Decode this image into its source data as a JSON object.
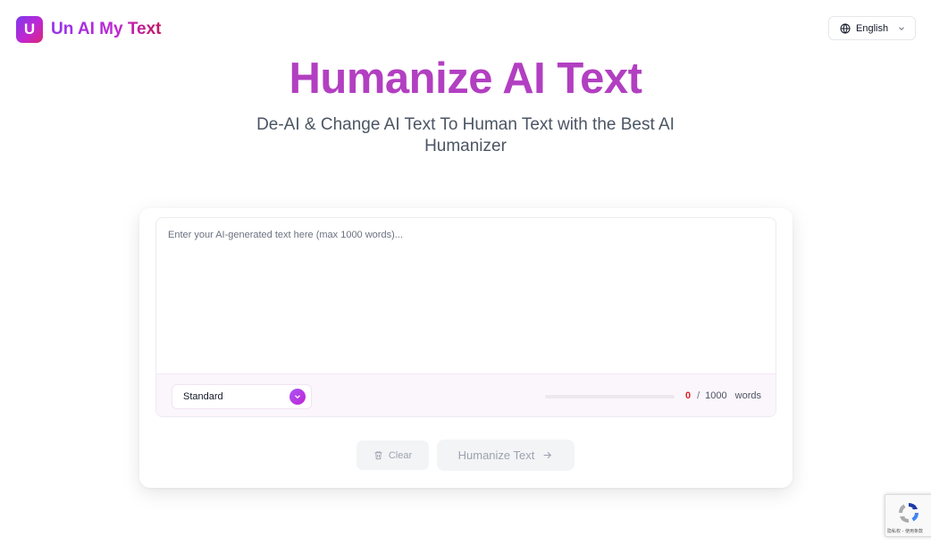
{
  "brand": {
    "logo_letter": "U",
    "name": "Un AI My Text"
  },
  "language": {
    "selected": "English",
    "icon": "globe-icon"
  },
  "hero": {
    "title": "Humanize AI Text",
    "subtitle": "De-AI & Change AI Text To Human Text with the Best AI Humanizer"
  },
  "editor": {
    "placeholder": "Enter your AI-generated text here (max 1000 words)...",
    "value": "",
    "mode": {
      "selected": "Standard"
    },
    "word_count": {
      "current": "0",
      "separator": "/",
      "max": "1000",
      "unit": "words",
      "progress_fraction": 0
    }
  },
  "actions": {
    "clear_label": "Clear",
    "humanize_label": "Humanize Text"
  },
  "recaptcha": {
    "footer_text": "隐私权 - 使用条款"
  },
  "colors": {
    "accent": "#b23fc1",
    "brand_gradient_start": "#7c3aed",
    "brand_gradient_end": "#db2777",
    "count_current": "#dc2626"
  }
}
